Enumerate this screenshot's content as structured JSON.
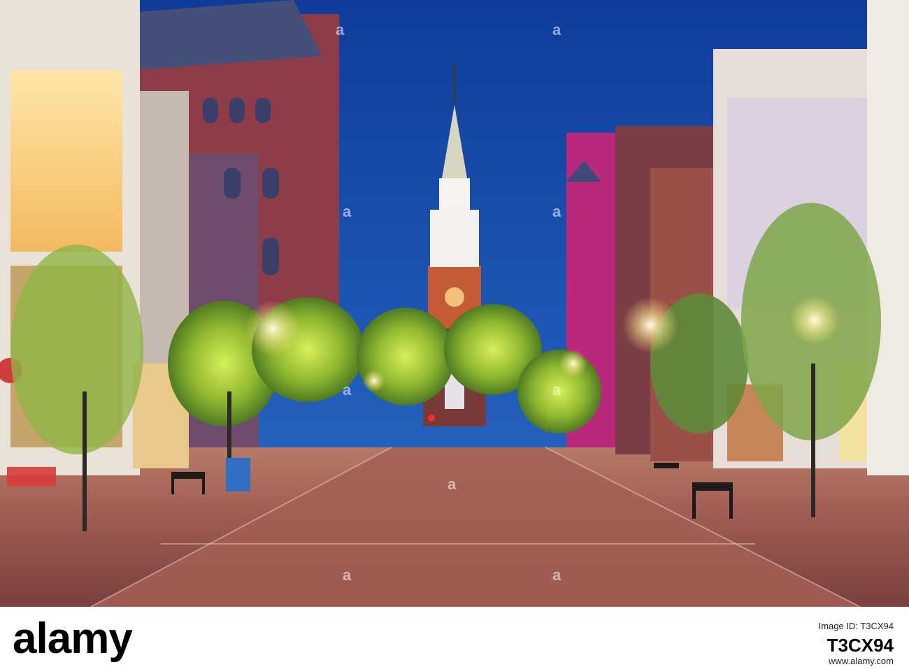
{
  "watermark": {
    "logo_text": "alamy"
  },
  "footer": {
    "logo_text": "alamy",
    "image_id_label": "Image ID: T3CX94",
    "image_id_value": "T3CX94",
    "website": "www.alamy.com"
  },
  "colors": {
    "sky": "#1f4fa6",
    "brick": "#8c4a45",
    "street": "#9a5a52",
    "foliage": "#8fb830",
    "lamp": "#fff3b0",
    "magenta_facade": "#b8287c"
  }
}
